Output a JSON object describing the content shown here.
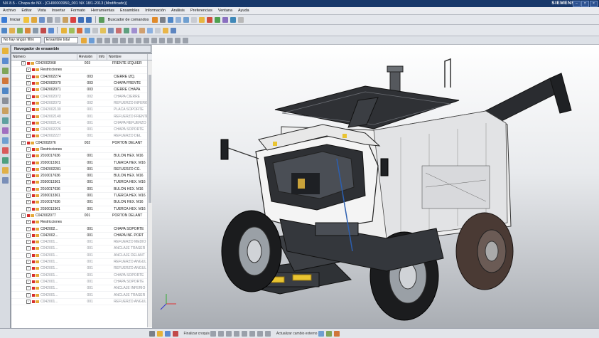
{
  "window": {
    "title": "NX 8.5 - Chapa de NX - [CH00000950_001 NX 18/1-2013 (Modificado)]",
    "brand": "SIEMENS",
    "controls": [
      "–",
      "□",
      "×"
    ]
  },
  "menu": [
    "Archivo",
    "Editar",
    "Vista",
    "Insertar",
    "Formato",
    "Herramientas",
    "Ensambles",
    "Información",
    "Análisis",
    "Preferencias",
    "Ventana",
    "Ayuda"
  ],
  "toolbar": {
    "start_label": "Iniciar",
    "command_finder": "Buscador de comandos",
    "filter_value": "No hay ningún filtro",
    "assembly_value": "Ensamble total"
  },
  "navigator": {
    "title": "Navegador de ensamble",
    "columns": [
      "Número",
      "Revisión",
      "Info",
      "Nombre"
    ],
    "rows": [
      {
        "num": "C042002068",
        "rev": "003",
        "name": "FRENTE IZQUIER",
        "indent": 2,
        "dim": false
      },
      {
        "num": "Restricciones",
        "rev": "",
        "name": "",
        "indent": 3,
        "dim": false
      },
      {
        "num": "C042002274",
        "rev": "003",
        "name": "CIERRE IZQ.",
        "indent": 3,
        "dim": false
      },
      {
        "num": "C042002070",
        "rev": "003",
        "name": "CHAPA FRENTE",
        "indent": 3,
        "dim": false
      },
      {
        "num": "C042002071",
        "rev": "003",
        "name": "CIERRE CHAPA",
        "indent": 3,
        "dim": false
      },
      {
        "num": "C042002072",
        "rev": "002",
        "name": "CHAPA CIERRE",
        "indent": 3,
        "dim": true
      },
      {
        "num": "C042002073",
        "rev": "002",
        "name": "REFUERZO INFERIO",
        "indent": 3,
        "dim": true
      },
      {
        "num": "C042002130",
        "rev": "001",
        "name": "PLACA SOPORTE",
        "indent": 3,
        "dim": true
      },
      {
        "num": "C042002140",
        "rev": "001",
        "name": "REFUERZO FRENTE",
        "indent": 3,
        "dim": true
      },
      {
        "num": "C042002141",
        "rev": "001",
        "name": "CHAPA REFUERZO",
        "indent": 3,
        "dim": true
      },
      {
        "num": "C042002226",
        "rev": "001",
        "name": "CHAPA SOPORTE",
        "indent": 3,
        "dim": true
      },
      {
        "num": "C042002227",
        "rev": "001",
        "name": "REFUERZO DEL",
        "indent": 3,
        "dim": true
      },
      {
        "num": "C042002076",
        "rev": "002",
        "name": "PORTON DELANT",
        "indent": 2,
        "dim": false
      },
      {
        "num": "Restricciones",
        "rev": "",
        "name": "",
        "indent": 3,
        "dim": false
      },
      {
        "num": "2010017636",
        "rev": "001",
        "name": "BULON HEX. M16",
        "indent": 3,
        "dim": false
      },
      {
        "num": "2030013361",
        "rev": "001",
        "name": "TUERCA HEX. M16",
        "indent": 3,
        "dim": false
      },
      {
        "num": "C042002281",
        "rev": "001",
        "name": "REFUERZO CG.",
        "indent": 3,
        "dim": false
      },
      {
        "num": "2010017636",
        "rev": "001",
        "name": "BULON HEX. M16",
        "indent": 3,
        "dim": false
      },
      {
        "num": "2030013361",
        "rev": "001",
        "name": "TUERCA HEX. M16",
        "indent": 3,
        "dim": false
      },
      {
        "num": "2010017636",
        "rev": "001",
        "name": "BULON HEX. M16",
        "indent": 3,
        "dim": false
      },
      {
        "num": "2030013361",
        "rev": "001",
        "name": "TUERCA HEX. M16",
        "indent": 3,
        "dim": false
      },
      {
        "num": "2010017636",
        "rev": "001",
        "name": "BULON HEX. M16",
        "indent": 3,
        "dim": false
      },
      {
        "num": "2030013361",
        "rev": "001",
        "name": "TUERCA HEX. M16",
        "indent": 3,
        "dim": false
      },
      {
        "num": "C042002077",
        "rev": "001",
        "name": "PORTON DELANT",
        "indent": 2,
        "dim": false
      },
      {
        "num": "Restricciones",
        "rev": "",
        "name": "",
        "indent": 3,
        "dim": false
      },
      {
        "num": "C042002...",
        "rev": "001",
        "name": "CHAPA SOPORTE",
        "indent": 3,
        "dim": false
      },
      {
        "num": "C042002...",
        "rev": "001",
        "name": "CHAPA INF. PORT",
        "indent": 3,
        "dim": false
      },
      {
        "num": "C042001...",
        "rev": "001",
        "name": "REFUERZO MEDIO",
        "indent": 3,
        "dim": true
      },
      {
        "num": "C042001...",
        "rev": "001",
        "name": "ANCLAJE TRASER",
        "indent": 3,
        "dim": true
      },
      {
        "num": "C042001...",
        "rev": "001",
        "name": "ANCLAJE DELANT",
        "indent": 3,
        "dim": true
      },
      {
        "num": "C042001...",
        "rev": "001",
        "name": "REFUERZO ANGUL",
        "indent": 3,
        "dim": true
      },
      {
        "num": "C042001...",
        "rev": "001",
        "name": "REFUERZO ANGUL",
        "indent": 3,
        "dim": true
      },
      {
        "num": "C042001...",
        "rev": "001",
        "name": "CHAPA SOPORTE",
        "indent": 3,
        "dim": true
      },
      {
        "num": "C042001...",
        "rev": "001",
        "name": "CHAPA SOPORTE",
        "indent": 3,
        "dim": true
      },
      {
        "num": "C042001...",
        "rev": "001",
        "name": "ANCLAJE INFERIO",
        "indent": 3,
        "dim": true
      },
      {
        "num": "C042001...",
        "rev": "001",
        "name": "ANCLAJE TRASER",
        "indent": 3,
        "dim": true
      },
      {
        "num": "C042001...",
        "rev": "001",
        "name": "REFUERZO ANGUL",
        "indent": 3,
        "dim": true
      }
    ]
  },
  "status": {
    "text": "Actualizar cambio externo",
    "sketch_hint": "Finalizar croquis"
  },
  "colors": {
    "title_bar": "#17386a",
    "machine_body": "#f2f2f2",
    "machine_dark": "#2a2c30",
    "accent_yellow": "#e9c431"
  }
}
